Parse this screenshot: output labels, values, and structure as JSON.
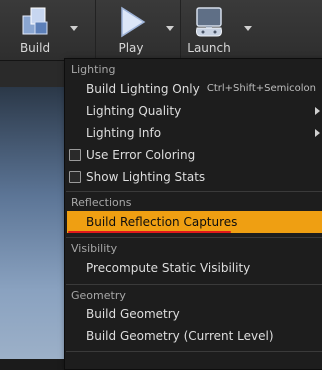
{
  "toolbar": {
    "buttons": [
      {
        "label": "Build",
        "icon": "build-cubes-icon"
      },
      {
        "label": "Play",
        "icon": "play-icon"
      },
      {
        "label": "Launch",
        "icon": "gamepad-monitor-icon"
      }
    ]
  },
  "menu": {
    "sections": [
      {
        "header": "Lighting",
        "items": [
          {
            "label": "Build Lighting Only",
            "shortcut": "Ctrl+Shift+Semicolon"
          },
          {
            "label": "Lighting Quality",
            "submenu": true
          },
          {
            "label": "Lighting Info",
            "submenu": true
          },
          {
            "label": "Use Error Coloring",
            "checkbox": true,
            "checked": false
          },
          {
            "label": "Show Lighting Stats",
            "checkbox": true,
            "checked": false
          }
        ]
      },
      {
        "header": "Reflections",
        "items": [
          {
            "label": "Build Reflection Captures",
            "highlighted": true
          }
        ]
      },
      {
        "header": "Visibility",
        "items": [
          {
            "label": "Precompute Static Visibility"
          }
        ]
      },
      {
        "header": "Geometry",
        "items": [
          {
            "label": "Build Geometry"
          },
          {
            "label": "Build Geometry (Current Level)"
          }
        ]
      }
    ]
  },
  "colors": {
    "highlight": "#ef9f12",
    "annotation": "#e0191b",
    "menu_bg": "#1d1d1d"
  }
}
